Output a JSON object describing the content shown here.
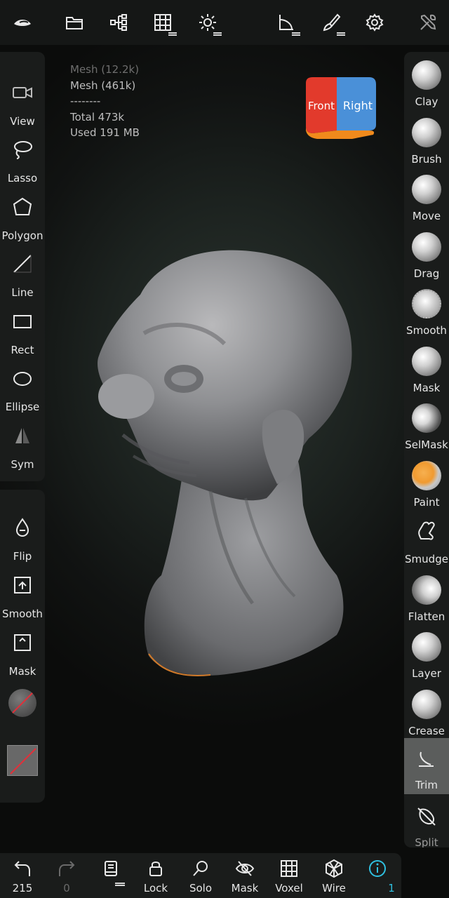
{
  "topbar": {
    "buttons": [
      "logo",
      "files",
      "scene",
      "topology",
      "lighting",
      "trim",
      "paint",
      "settings",
      "tools"
    ]
  },
  "mesh_info": {
    "line1": "Mesh (12.2k)",
    "line2": "Mesh (461k)",
    "separator": "--------",
    "total": "Total 473k",
    "used": "Used 191 MB"
  },
  "view_cube": {
    "front": "Front",
    "right": "Right"
  },
  "left_tools": [
    {
      "label": "View",
      "icon": "camera-icon"
    },
    {
      "label": "Lasso",
      "icon": "lasso-icon"
    },
    {
      "label": "Polygon",
      "icon": "polygon-icon"
    },
    {
      "label": "Line",
      "icon": "line-icon"
    },
    {
      "label": "Rect",
      "icon": "rect-icon"
    },
    {
      "label": "Ellipse",
      "icon": "ellipse-icon"
    },
    {
      "label": "Sym",
      "icon": "symmetry-icon"
    }
  ],
  "left_actions": [
    {
      "label": "Flip",
      "icon": "drop-icon"
    },
    {
      "label": "Smooth",
      "icon": "smooth-icon"
    },
    {
      "label": "Mask",
      "icon": "mask-icon"
    }
  ],
  "right_tools": [
    {
      "label": "Clay"
    },
    {
      "label": "Brush"
    },
    {
      "label": "Move"
    },
    {
      "label": "Drag"
    },
    {
      "label": "Smooth"
    },
    {
      "label": "Mask"
    },
    {
      "label": "SelMask"
    },
    {
      "label": "Paint"
    },
    {
      "label": "Smudge"
    },
    {
      "label": "Flatten"
    },
    {
      "label": "Layer"
    },
    {
      "label": "Crease"
    },
    {
      "label": "Trim"
    },
    {
      "label": "Split"
    }
  ],
  "active_tool": "Trim",
  "bottombar": {
    "undo": "215",
    "redo": "0",
    "lock": "Lock",
    "solo": "Solo",
    "mask": "Mask",
    "voxel": "Voxel",
    "wire": "Wire",
    "info_count": "1"
  },
  "colors": {
    "accent": "#2fc0e0",
    "panel": "#1a1c1b",
    "paint_orange": "#f09a30"
  }
}
